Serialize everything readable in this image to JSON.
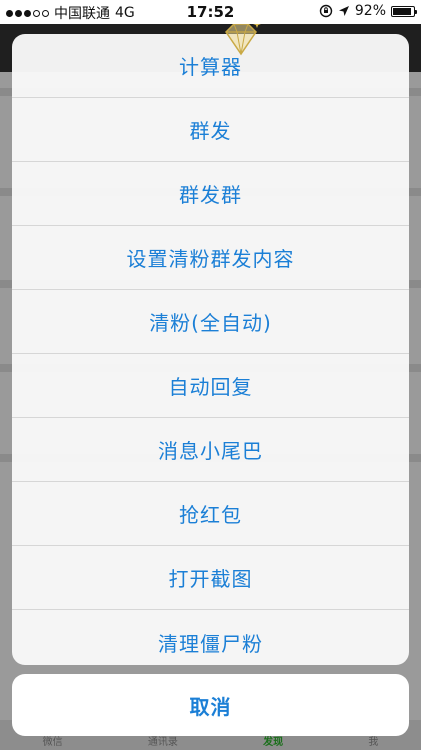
{
  "status_bar": {
    "carrier": "中国联通",
    "network": "4G",
    "time": "17:52",
    "battery_percent": "92%",
    "battery_level": 0.92
  },
  "action_sheet": {
    "items": [
      {
        "label": "计算器"
      },
      {
        "label": "群发"
      },
      {
        "label": "群发群"
      },
      {
        "label": "设置清粉群发内容"
      },
      {
        "label": "清粉(全自动)"
      },
      {
        "label": "自动回复"
      },
      {
        "label": "消息小尾巴"
      },
      {
        "label": "抢红包"
      },
      {
        "label": "打开截图"
      },
      {
        "label": "清理僵尸粉"
      }
    ],
    "cancel_label": "取消"
  },
  "tab_bar": {
    "tabs": [
      {
        "label": "微信"
      },
      {
        "label": "通讯录"
      },
      {
        "label": "发现"
      },
      {
        "label": "我"
      }
    ]
  },
  "colors": {
    "accent": "#1b7fd6",
    "active_tab": "#1a6f1a"
  }
}
